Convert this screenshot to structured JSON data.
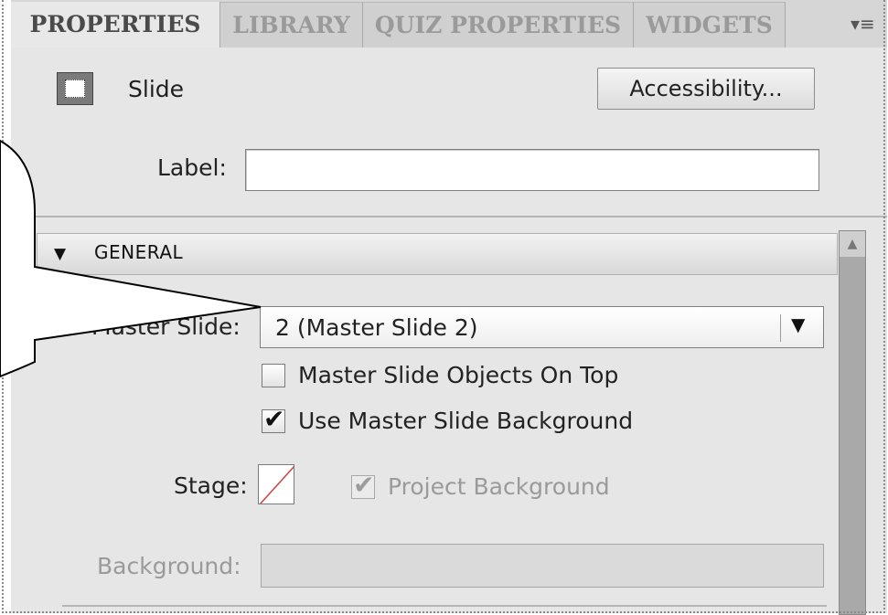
{
  "tabs": [
    {
      "label": "PROPERTIES",
      "active": true
    },
    {
      "label": "LIBRARY",
      "active": false
    },
    {
      "label": "QUIZ PROPERTIES",
      "active": false
    },
    {
      "label": "WIDGETS",
      "active": false
    }
  ],
  "panel_menu_icon": "▾≡",
  "header": {
    "object_icon": "slide-icon",
    "object_type": "Slide",
    "accessibility_button": "Accessibility..."
  },
  "label_field": {
    "caption": "Label:",
    "value": ""
  },
  "general_section": {
    "collapse_arrow": "▼",
    "title": "GENERAL",
    "master_slide": {
      "caption": "Master Slide:",
      "selected": "2 (Master Slide 2)",
      "dropdown_arrow": "▼"
    },
    "objects_on_top": {
      "label": "Master Slide Objects On Top",
      "checked": false
    },
    "use_master_background": {
      "label": "Use Master Slide Background",
      "checked": true,
      "check_glyph": "✔"
    },
    "stage": {
      "caption": "Stage:",
      "swatch": "none"
    },
    "project_background": {
      "label": "Project Background",
      "checked": true,
      "disabled": true,
      "check_glyph": "✔"
    },
    "background": {
      "caption": "Background:",
      "value": "",
      "disabled": true
    }
  },
  "scrollbar_up_arrow": "▲",
  "colors": {
    "panel_bg": "#e6e6e6",
    "tab_bar_bg": "#d0d0d0",
    "disabled_text": "#9a9a9a",
    "swatch_slash": "#d04040"
  }
}
